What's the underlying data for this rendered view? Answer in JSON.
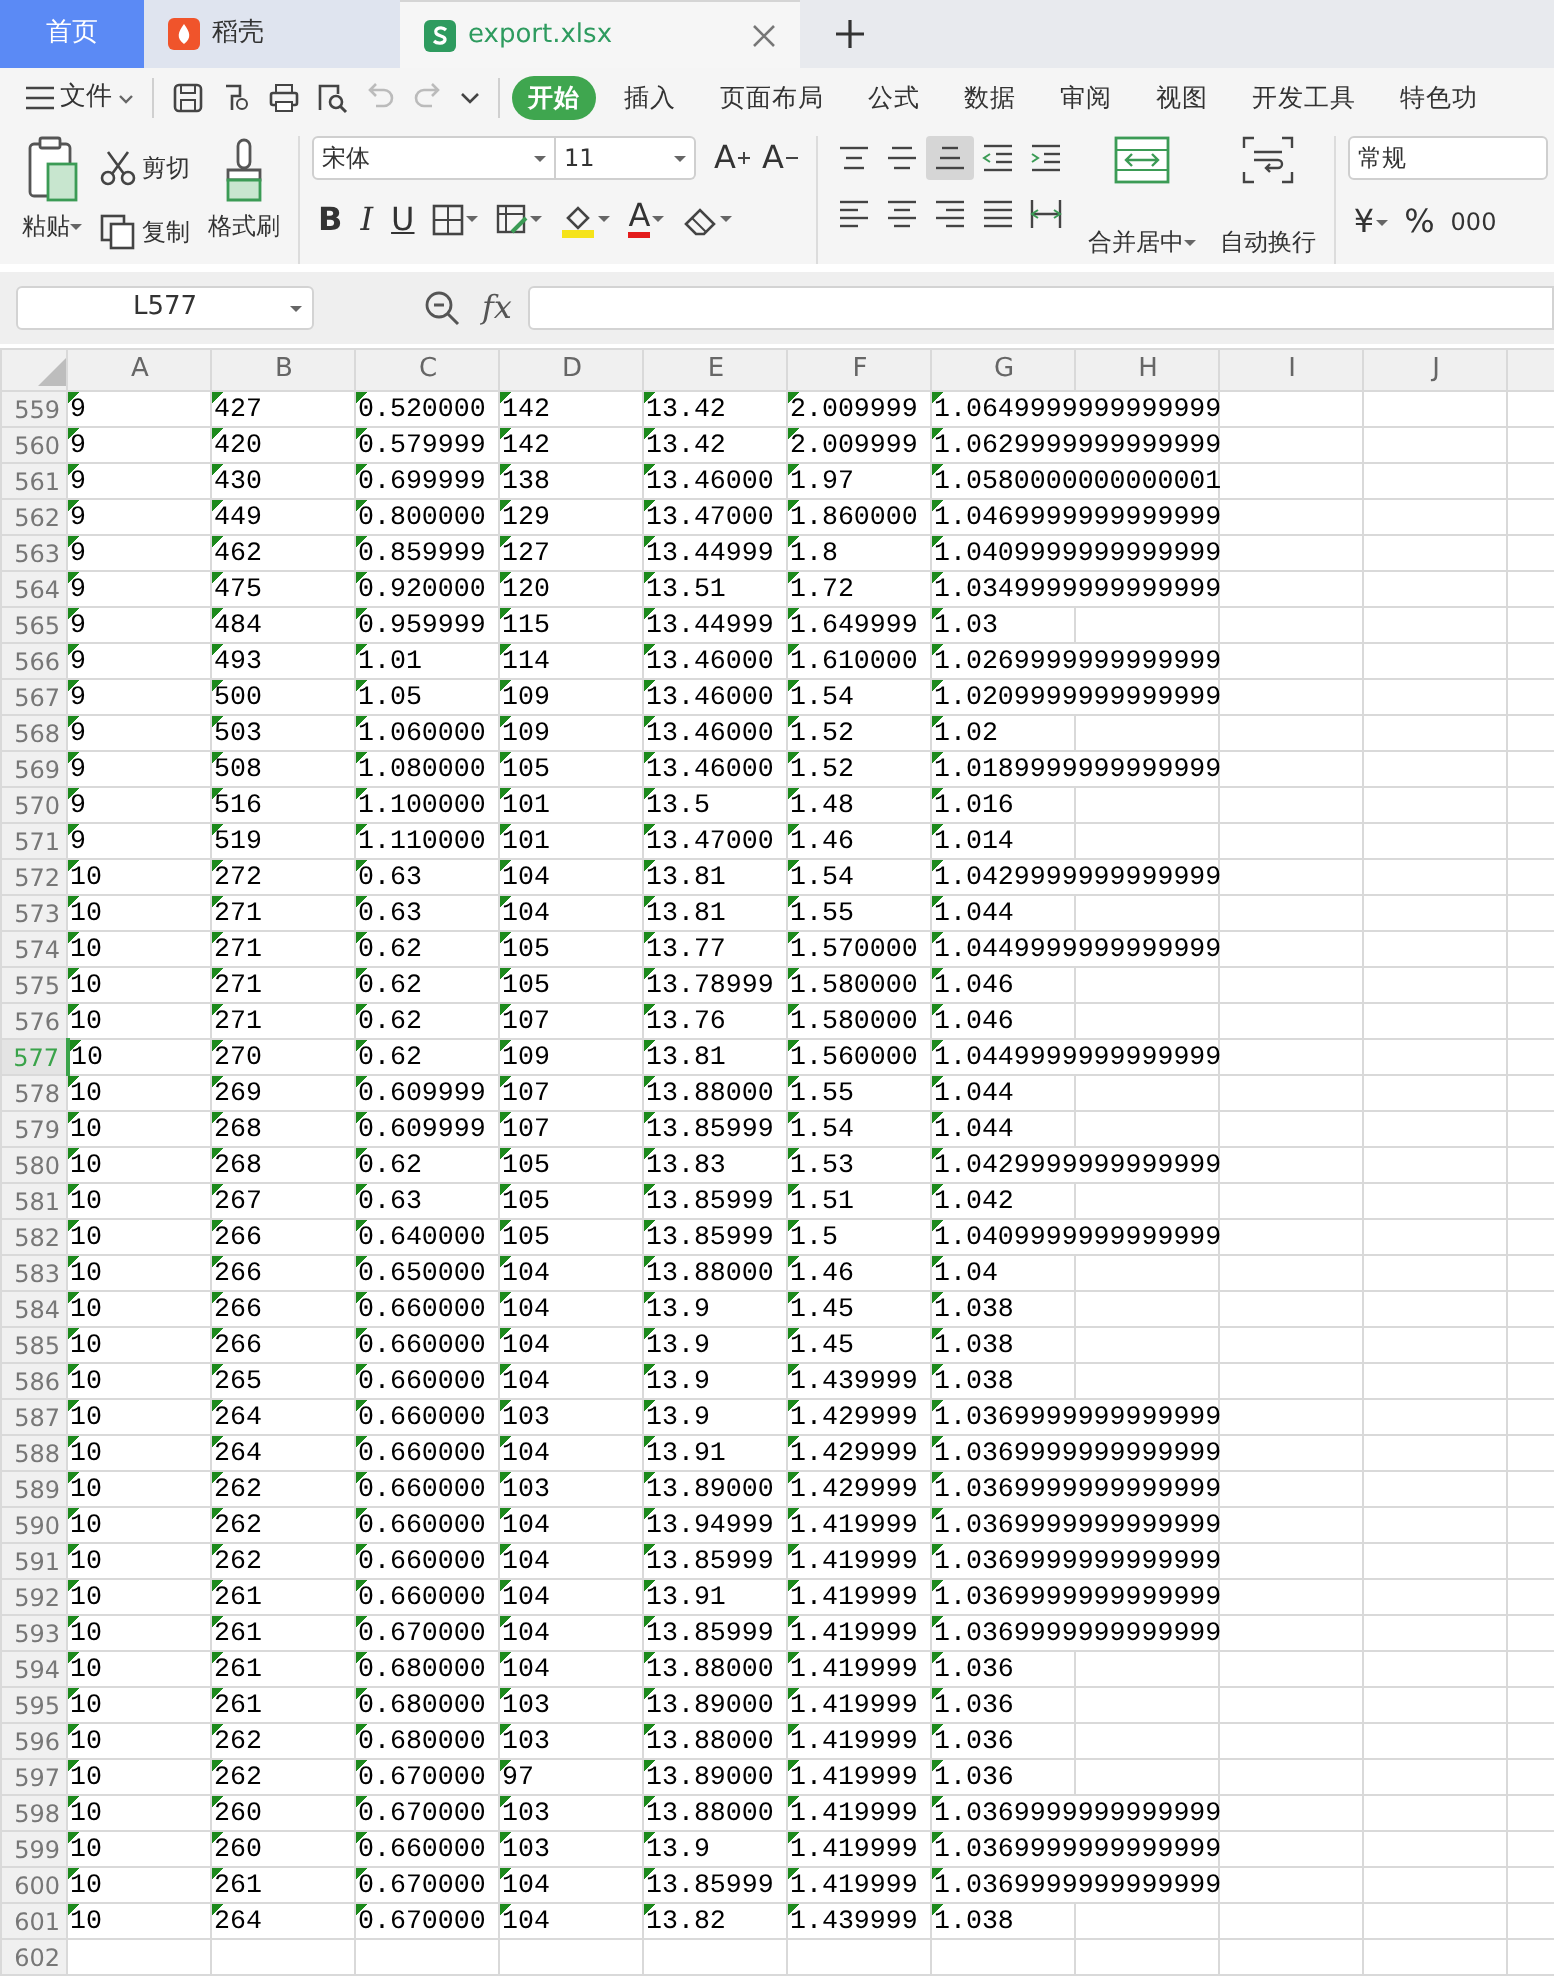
{
  "tabs": [
    {
      "label": "首页",
      "kind": "home",
      "selected": false
    },
    {
      "label": "稻壳",
      "kind": "docer",
      "selected": false
    },
    {
      "label": "export.xlsx",
      "kind": "sheet",
      "selected": true
    }
  ],
  "menu": {
    "file": "文件",
    "ribbon_tabs": [
      {
        "label": "开始",
        "selected": true
      },
      {
        "label": "插入",
        "selected": false
      },
      {
        "label": "页面布局",
        "selected": false
      },
      {
        "label": "公式",
        "selected": false
      },
      {
        "label": "数据",
        "selected": false
      },
      {
        "label": "审阅",
        "selected": false
      },
      {
        "label": "视图",
        "selected": false
      },
      {
        "label": "开发工具",
        "selected": false
      },
      {
        "label": "特色功",
        "selected": false
      }
    ]
  },
  "ribbon": {
    "paste": "粘贴",
    "cut": "剪切",
    "copy": "复制",
    "format_painter": "格式刷",
    "font": "宋体",
    "font_size": "11",
    "grow": "A",
    "shrink": "A",
    "bold": "B",
    "italic": "I",
    "underline": "U",
    "font_color": "A",
    "align_top": [
      {
        "selected": false
      },
      {
        "selected": false
      },
      {
        "selected": true
      }
    ],
    "merge": "合并居中",
    "wrap": "自动换行",
    "number_format": "常规",
    "currency": "¥",
    "percent": "%",
    "thousands": "000"
  },
  "formula_bar": {
    "name_box": "L577",
    "fx": "fx"
  },
  "columns": [
    "A",
    "B",
    "C",
    "D",
    "E",
    "F",
    "G",
    "H",
    "I",
    "J"
  ],
  "rows": [
    {
      "number": "559",
      "selected": false,
      "cells": [
        "9",
        "427",
        "0.520000",
        "142",
        "13.42",
        "2.009999",
        "1.0649999999999999"
      ]
    },
    {
      "number": "560",
      "selected": false,
      "cells": [
        "9",
        "420",
        "0.579999",
        "142",
        "13.42",
        "2.009999",
        "1.0629999999999999"
      ]
    },
    {
      "number": "561",
      "selected": false,
      "cells": [
        "9",
        "430",
        "0.699999",
        "138",
        "13.46000",
        "1.97",
        "1.0580000000000001"
      ]
    },
    {
      "number": "562",
      "selected": false,
      "cells": [
        "9",
        "449",
        "0.800000",
        "129",
        "13.47000",
        "1.860000",
        "1.0469999999999999"
      ]
    },
    {
      "number": "563",
      "selected": false,
      "cells": [
        "9",
        "462",
        "0.859999",
        "127",
        "13.44999",
        "1.8",
        "1.0409999999999999"
      ]
    },
    {
      "number": "564",
      "selected": false,
      "cells": [
        "9",
        "475",
        "0.920000",
        "120",
        "13.51",
        "1.72",
        "1.0349999999999999"
      ]
    },
    {
      "number": "565",
      "selected": false,
      "cells": [
        "9",
        "484",
        "0.959999",
        "115",
        "13.44999",
        "1.649999",
        "1.03"
      ]
    },
    {
      "number": "566",
      "selected": false,
      "cells": [
        "9",
        "493",
        "1.01",
        "114",
        "13.46000",
        "1.610000",
        "1.0269999999999999"
      ]
    },
    {
      "number": "567",
      "selected": false,
      "cells": [
        "9",
        "500",
        "1.05",
        "109",
        "13.46000",
        "1.54",
        "1.0209999999999999"
      ]
    },
    {
      "number": "568",
      "selected": false,
      "cells": [
        "9",
        "503",
        "1.060000",
        "109",
        "13.46000",
        "1.52",
        "1.02"
      ]
    },
    {
      "number": "569",
      "selected": false,
      "cells": [
        "9",
        "508",
        "1.080000",
        "105",
        "13.46000",
        "1.52",
        "1.0189999999999999"
      ]
    },
    {
      "number": "570",
      "selected": false,
      "cells": [
        "9",
        "516",
        "1.100000",
        "101",
        "13.5",
        "1.48",
        "1.016"
      ]
    },
    {
      "number": "571",
      "selected": false,
      "cells": [
        "9",
        "519",
        "1.110000",
        "101",
        "13.47000",
        "1.46",
        "1.014"
      ]
    },
    {
      "number": "572",
      "selected": false,
      "cells": [
        "10",
        "272",
        "0.63",
        "104",
        "13.81",
        "1.54",
        "1.0429999999999999"
      ]
    },
    {
      "number": "573",
      "selected": false,
      "cells": [
        "10",
        "271",
        "0.63",
        "104",
        "13.81",
        "1.55",
        "1.044"
      ]
    },
    {
      "number": "574",
      "selected": false,
      "cells": [
        "10",
        "271",
        "0.62",
        "105",
        "13.77",
        "1.570000",
        "1.0449999999999999"
      ]
    },
    {
      "number": "575",
      "selected": false,
      "cells": [
        "10",
        "271",
        "0.62",
        "105",
        "13.78999",
        "1.580000",
        "1.046"
      ]
    },
    {
      "number": "576",
      "selected": false,
      "cells": [
        "10",
        "271",
        "0.62",
        "107",
        "13.76",
        "1.580000",
        "1.046"
      ]
    },
    {
      "number": "577",
      "selected": true,
      "cells": [
        "10",
        "270",
        "0.62",
        "109",
        "13.81",
        "1.560000",
        "1.0449999999999999"
      ]
    },
    {
      "number": "578",
      "selected": false,
      "cells": [
        "10",
        "269",
        "0.609999",
        "107",
        "13.88000",
        "1.55",
        "1.044"
      ]
    },
    {
      "number": "579",
      "selected": false,
      "cells": [
        "10",
        "268",
        "0.609999",
        "107",
        "13.85999",
        "1.54",
        "1.044"
      ]
    },
    {
      "number": "580",
      "selected": false,
      "cells": [
        "10",
        "268",
        "0.62",
        "105",
        "13.83",
        "1.53",
        "1.0429999999999999"
      ]
    },
    {
      "number": "581",
      "selected": false,
      "cells": [
        "10",
        "267",
        "0.63",
        "105",
        "13.85999",
        "1.51",
        "1.042"
      ]
    },
    {
      "number": "582",
      "selected": false,
      "cells": [
        "10",
        "266",
        "0.640000",
        "105",
        "13.85999",
        "1.5",
        "1.0409999999999999"
      ]
    },
    {
      "number": "583",
      "selected": false,
      "cells": [
        "10",
        "266",
        "0.650000",
        "104",
        "13.88000",
        "1.46",
        "1.04"
      ]
    },
    {
      "number": "584",
      "selected": false,
      "cells": [
        "10",
        "266",
        "0.660000",
        "104",
        "13.9",
        "1.45",
        "1.038"
      ]
    },
    {
      "number": "585",
      "selected": false,
      "cells": [
        "10",
        "266",
        "0.660000",
        "104",
        "13.9",
        "1.45",
        "1.038"
      ]
    },
    {
      "number": "586",
      "selected": false,
      "cells": [
        "10",
        "265",
        "0.660000",
        "104",
        "13.9",
        "1.439999",
        "1.038"
      ]
    },
    {
      "number": "587",
      "selected": false,
      "cells": [
        "10",
        "264",
        "0.660000",
        "103",
        "13.9",
        "1.429999",
        "1.0369999999999999"
      ]
    },
    {
      "number": "588",
      "selected": false,
      "cells": [
        "10",
        "264",
        "0.660000",
        "104",
        "13.91",
        "1.429999",
        "1.0369999999999999"
      ]
    },
    {
      "number": "589",
      "selected": false,
      "cells": [
        "10",
        "262",
        "0.660000",
        "103",
        "13.89000",
        "1.429999",
        "1.0369999999999999"
      ]
    },
    {
      "number": "590",
      "selected": false,
      "cells": [
        "10",
        "262",
        "0.660000",
        "104",
        "13.94999",
        "1.419999",
        "1.0369999999999999"
      ]
    },
    {
      "number": "591",
      "selected": false,
      "cells": [
        "10",
        "262",
        "0.660000",
        "104",
        "13.85999",
        "1.419999",
        "1.0369999999999999"
      ]
    },
    {
      "number": "592",
      "selected": false,
      "cells": [
        "10",
        "261",
        "0.660000",
        "104",
        "13.91",
        "1.419999",
        "1.0369999999999999"
      ]
    },
    {
      "number": "593",
      "selected": false,
      "cells": [
        "10",
        "261",
        "0.670000",
        "104",
        "13.85999",
        "1.419999",
        "1.0369999999999999"
      ]
    },
    {
      "number": "594",
      "selected": false,
      "cells": [
        "10",
        "261",
        "0.680000",
        "104",
        "13.88000",
        "1.419999",
        "1.036"
      ]
    },
    {
      "number": "595",
      "selected": false,
      "cells": [
        "10",
        "261",
        "0.680000",
        "103",
        "13.89000",
        "1.419999",
        "1.036"
      ]
    },
    {
      "number": "596",
      "selected": false,
      "cells": [
        "10",
        "262",
        "0.680000",
        "103",
        "13.88000",
        "1.419999",
        "1.036"
      ]
    },
    {
      "number": "597",
      "selected": false,
      "cells": [
        "10",
        "262",
        "0.670000",
        "97",
        "13.89000",
        "1.419999",
        "1.036"
      ]
    },
    {
      "number": "598",
      "selected": false,
      "cells": [
        "10",
        "260",
        "0.670000",
        "103",
        "13.88000",
        "1.419999",
        "1.0369999999999999"
      ]
    },
    {
      "number": "599",
      "selected": false,
      "cells": [
        "10",
        "260",
        "0.660000",
        "103",
        "13.9",
        "1.419999",
        "1.0369999999999999"
      ]
    },
    {
      "number": "600",
      "selected": false,
      "cells": [
        "10",
        "261",
        "0.670000",
        "104",
        "13.85999",
        "1.419999",
        "1.0369999999999999"
      ]
    },
    {
      "number": "601",
      "selected": false,
      "cells": [
        "10",
        "264",
        "0.670000",
        "104",
        "13.82",
        "1.439999",
        "1.038"
      ]
    },
    {
      "number": "602",
      "selected": false
    }
  ]
}
